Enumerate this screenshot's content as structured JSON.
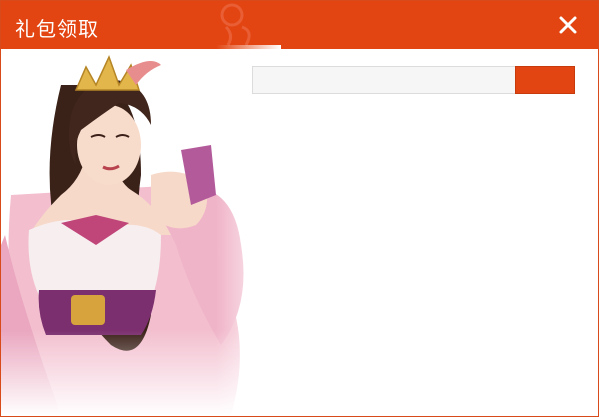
{
  "window": {
    "title": "礼包领取"
  },
  "icons": {
    "close": "close-icon",
    "watermark": "logo-watermark"
  },
  "form": {
    "code_value": "",
    "code_placeholder": "",
    "submit_label": ""
  },
  "illustration": {
    "name": "character-portrait"
  },
  "colors": {
    "accent": "#e24512",
    "input_bg": "#f6f6f6",
    "input_border": "#dcdcdc"
  }
}
